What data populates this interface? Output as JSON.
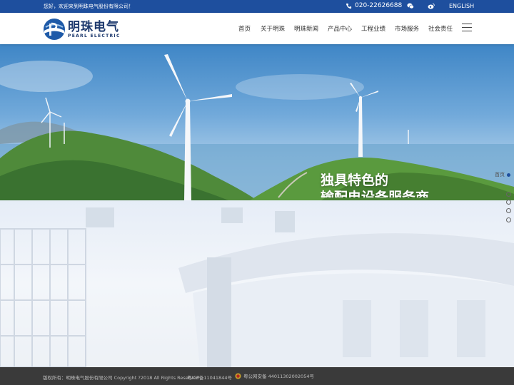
{
  "topbar": {
    "welcome": "您好，欢迎来到明珠电气股份有限公司！",
    "phone": "020-22626688",
    "lang": "ENGLISH",
    "icons": [
      "phone-icon",
      "wechat-icon",
      "weibo-icon"
    ]
  },
  "header": {
    "logo_cn": "明珠电气",
    "logo_en": "PEARL ELECTRIC",
    "nav": [
      "首页",
      "关于明珠",
      "明珠新闻",
      "产品中心",
      "工程业绩",
      "市场服务",
      "社会责任"
    ]
  },
  "banner": {
    "slogan_line1": "独具特色的",
    "slogan_line2": "输配电设备服务商",
    "home_tag": "首页"
  },
  "footer": {
    "copyright": "版权所有：明珠电气股份有限公司 Copyright ?2018 All Rights Reserved",
    "icp": "粤ICP备11041844号",
    "police": "粤公网安备 44011302002054号"
  },
  "colors": {
    "brand_blue": "#1e4f9e",
    "footer_bg": "#3a3a3a"
  }
}
